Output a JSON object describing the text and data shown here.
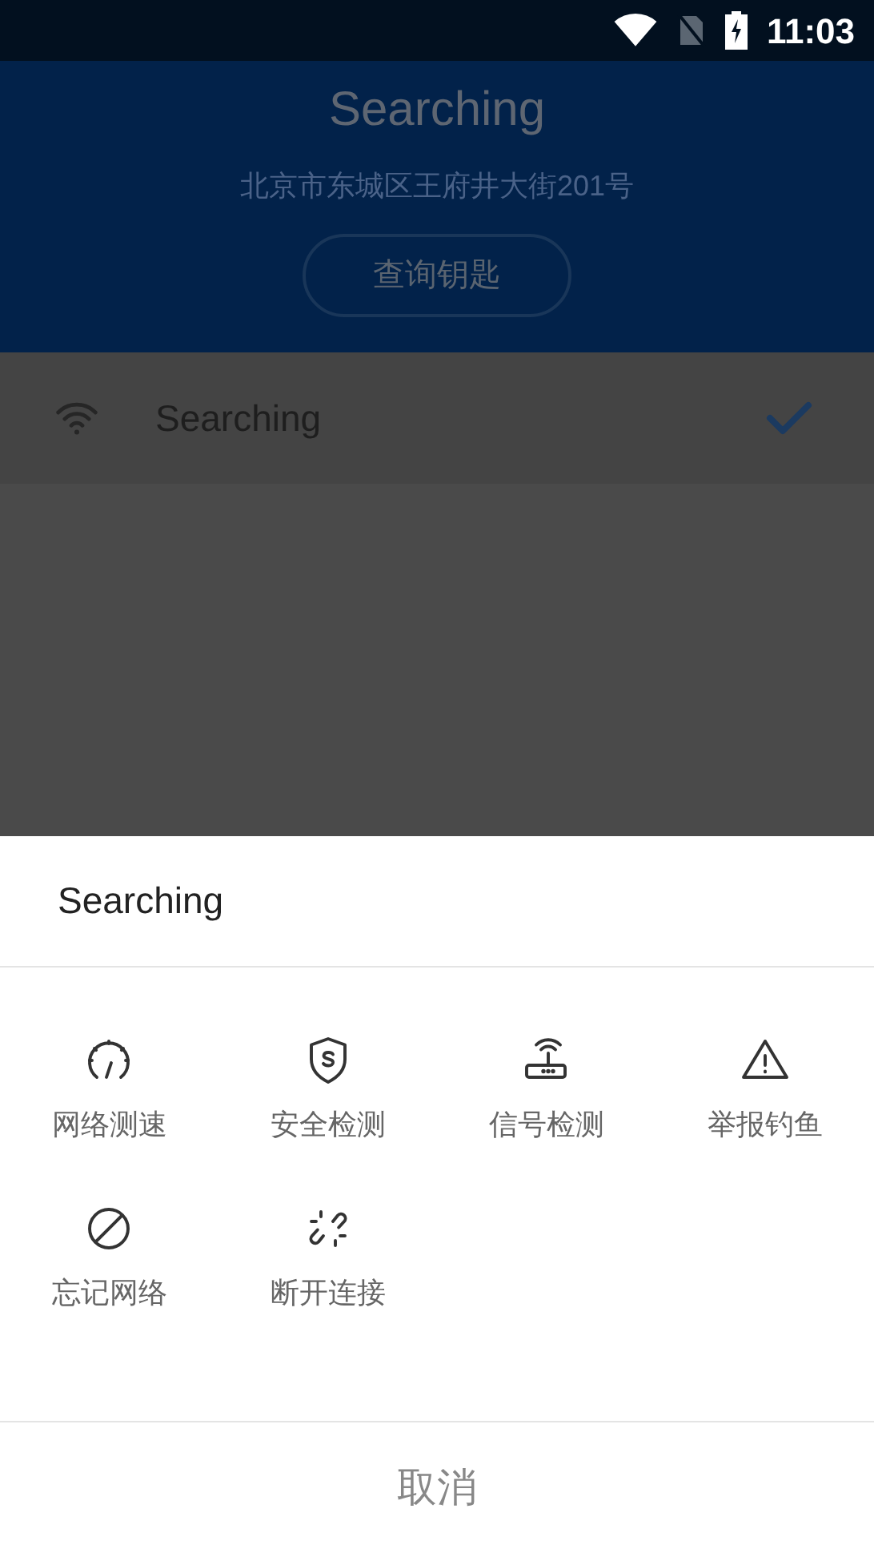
{
  "status_bar": {
    "time": "11:03"
  },
  "header": {
    "title": "Searching",
    "address": "北京市东城区王府井大街201号",
    "button": "查询钥匙"
  },
  "networks": [
    {
      "name": "Searching",
      "selected": true
    }
  ],
  "sheet": {
    "title": "Searching",
    "actions": [
      {
        "label": "网络测速"
      },
      {
        "label": "安全检测"
      },
      {
        "label": "信号检测"
      },
      {
        "label": "举报钓鱼"
      },
      {
        "label": "忘记网络"
      },
      {
        "label": "断开连接"
      }
    ],
    "cancel": "取消"
  }
}
